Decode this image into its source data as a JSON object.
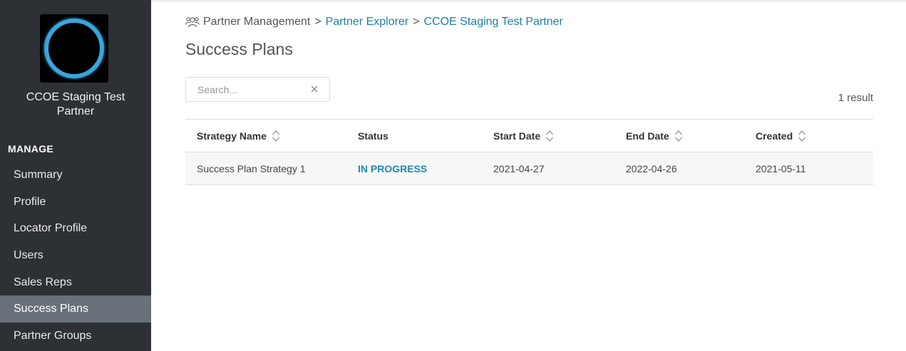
{
  "sidebar": {
    "partner_name": "CCOE Staging Test Partner",
    "section_heading": "MANAGE",
    "items": [
      {
        "label": "Summary"
      },
      {
        "label": "Profile"
      },
      {
        "label": "Locator Profile"
      },
      {
        "label": "Users"
      },
      {
        "label": "Sales Reps"
      },
      {
        "label": "Success Plans",
        "active": true
      },
      {
        "label": "Partner Groups"
      }
    ]
  },
  "breadcrumb": {
    "root": "Partner Management",
    "separator": ">",
    "level1": "Partner Explorer",
    "level2": "CCOE Staging Test Partner"
  },
  "page": {
    "title": "Success Plans"
  },
  "search": {
    "placeholder": "Search...",
    "value": ""
  },
  "results": {
    "count_text": "1 result"
  },
  "table": {
    "columns": [
      "Strategy Name",
      "Status",
      "Start Date",
      "End Date",
      "Created"
    ],
    "rows": [
      {
        "strategy_name": "Success Plan Strategy 1",
        "status": "IN PROGRESS",
        "start_date": "2021-04-27",
        "end_date": "2022-04-26",
        "created": "2021-05-11"
      }
    ]
  },
  "colors": {
    "sidebar_bg": "#2d3035",
    "active_item_bg": "#687079",
    "link": "#1d7ea3",
    "status": "#1d8ab0",
    "logo_ring": "#3aa5dc"
  }
}
